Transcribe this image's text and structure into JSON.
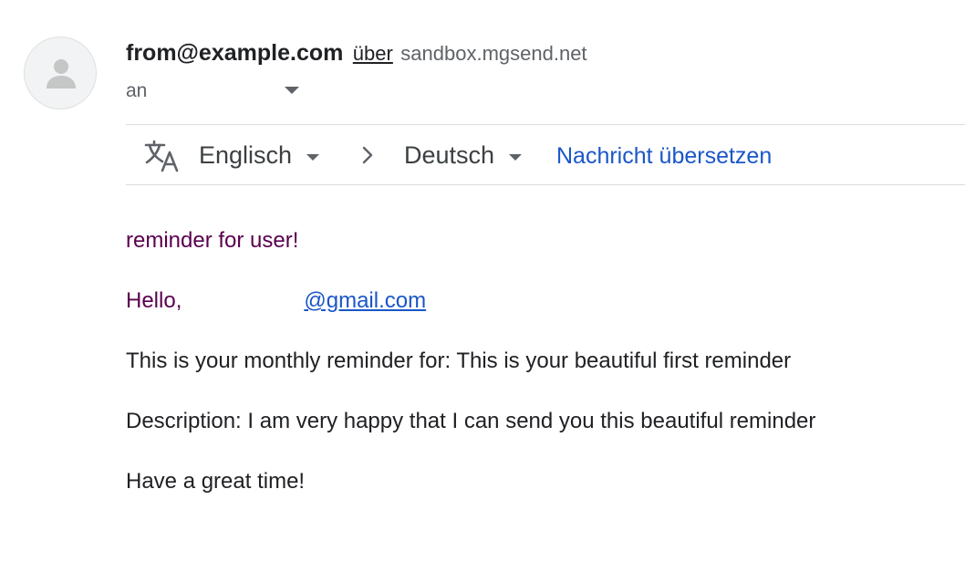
{
  "sender": {
    "name": "from@example.com",
    "via_word": "über",
    "via_domain": "sandbox.mgsend.net"
  },
  "recipient": {
    "label": "an"
  },
  "translate_bar": {
    "source_language": "Englisch",
    "target_language": "Deutsch",
    "action_label": "Nachricht übersetzen"
  },
  "message": {
    "subject_line": "reminder for user!",
    "greeting": "Hello,",
    "email_link": "@gmail.com",
    "line1": "This is your monthly reminder for: This is your beautiful first reminder",
    "line2": "Description: I am very happy that I can send you this beautiful reminder",
    "line3": "Have a great time!"
  },
  "colors": {
    "link": "#1a57c7",
    "visited_text": "#5a004e",
    "muted": "#5f6368"
  },
  "icons": [
    "person-icon",
    "translate-icon",
    "chevron-down-icon",
    "chevron-right-icon"
  ]
}
